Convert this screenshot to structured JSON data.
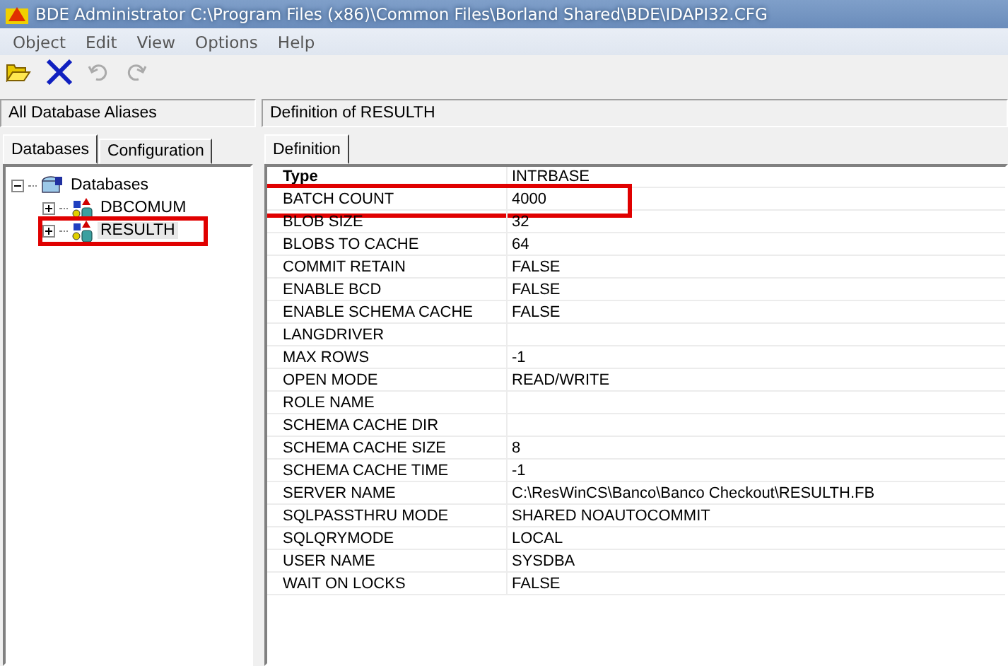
{
  "window": {
    "title": "BDE Administrator  C:\\Program Files (x86)\\Common Files\\Borland Shared\\BDE\\IDAPI32.CFG"
  },
  "menu": [
    "Object",
    "Edit",
    "View",
    "Options",
    "Help"
  ],
  "left_panel": {
    "header": "All Database Aliases",
    "tabs": [
      {
        "label": "Databases",
        "selected": true
      },
      {
        "label": "Configuration",
        "selected": false
      }
    ],
    "tree": {
      "label": "Databases",
      "expanded": true,
      "children": [
        {
          "label": "DBCOMUM",
          "expanded": false,
          "selected": false,
          "highlighted": false
        },
        {
          "label": "RESULTH",
          "expanded": false,
          "selected": true,
          "highlighted": true
        }
      ]
    }
  },
  "right_panel": {
    "header": "Definition of RESULTH",
    "tabs": [
      {
        "label": "Definition",
        "selected": true
      }
    ],
    "rows": [
      {
        "name": "Type",
        "value": "INTRBASE",
        "bold": true,
        "highlighted": false
      },
      {
        "name": "BATCH COUNT",
        "value": "4000",
        "bold": false,
        "highlighted": true
      },
      {
        "name": "BLOB SIZE",
        "value": "32",
        "bold": false,
        "highlighted": false
      },
      {
        "name": "BLOBS TO CACHE",
        "value": "64",
        "bold": false,
        "highlighted": false
      },
      {
        "name": "COMMIT RETAIN",
        "value": "FALSE",
        "bold": false,
        "highlighted": false
      },
      {
        "name": "ENABLE BCD",
        "value": "FALSE",
        "bold": false,
        "highlighted": false
      },
      {
        "name": "ENABLE SCHEMA CACHE",
        "value": "FALSE",
        "bold": false,
        "highlighted": false
      },
      {
        "name": "LANGDRIVER",
        "bold": false,
        "highlighted": false
      },
      {
        "name": "MAX ROWS",
        "value": "-1",
        "bold": false,
        "highlighted": false
      },
      {
        "name": "OPEN MODE",
        "value": "READ/WRITE",
        "bold": false,
        "highlighted": false
      },
      {
        "name": "ROLE NAME",
        "bold": false,
        "highlighted": false
      },
      {
        "name": "SCHEMA CACHE DIR",
        "bold": false,
        "highlighted": false
      },
      {
        "name": "SCHEMA CACHE SIZE",
        "value": "8",
        "bold": false,
        "highlighted": false
      },
      {
        "name": "SCHEMA CACHE TIME",
        "value": "-1",
        "bold": false,
        "highlighted": false
      },
      {
        "name": "SERVER NAME",
        "value": "C:\\ResWinCS\\Banco\\Banco Checkout\\RESULTH.FB",
        "bold": false,
        "highlighted": false
      },
      {
        "name": "SQLPASSTHRU MODE",
        "value": "SHARED NOAUTOCOMMIT",
        "bold": false,
        "highlighted": false
      },
      {
        "name": "SQLQRYMODE",
        "value": "LOCAL",
        "bold": false,
        "highlighted": false
      },
      {
        "name": "USER NAME",
        "value": "SYSDBA",
        "bold": false,
        "highlighted": false
      },
      {
        "name": "WAIT ON LOCKS",
        "value": "FALSE",
        "bold": false,
        "highlighted": false
      }
    ]
  }
}
